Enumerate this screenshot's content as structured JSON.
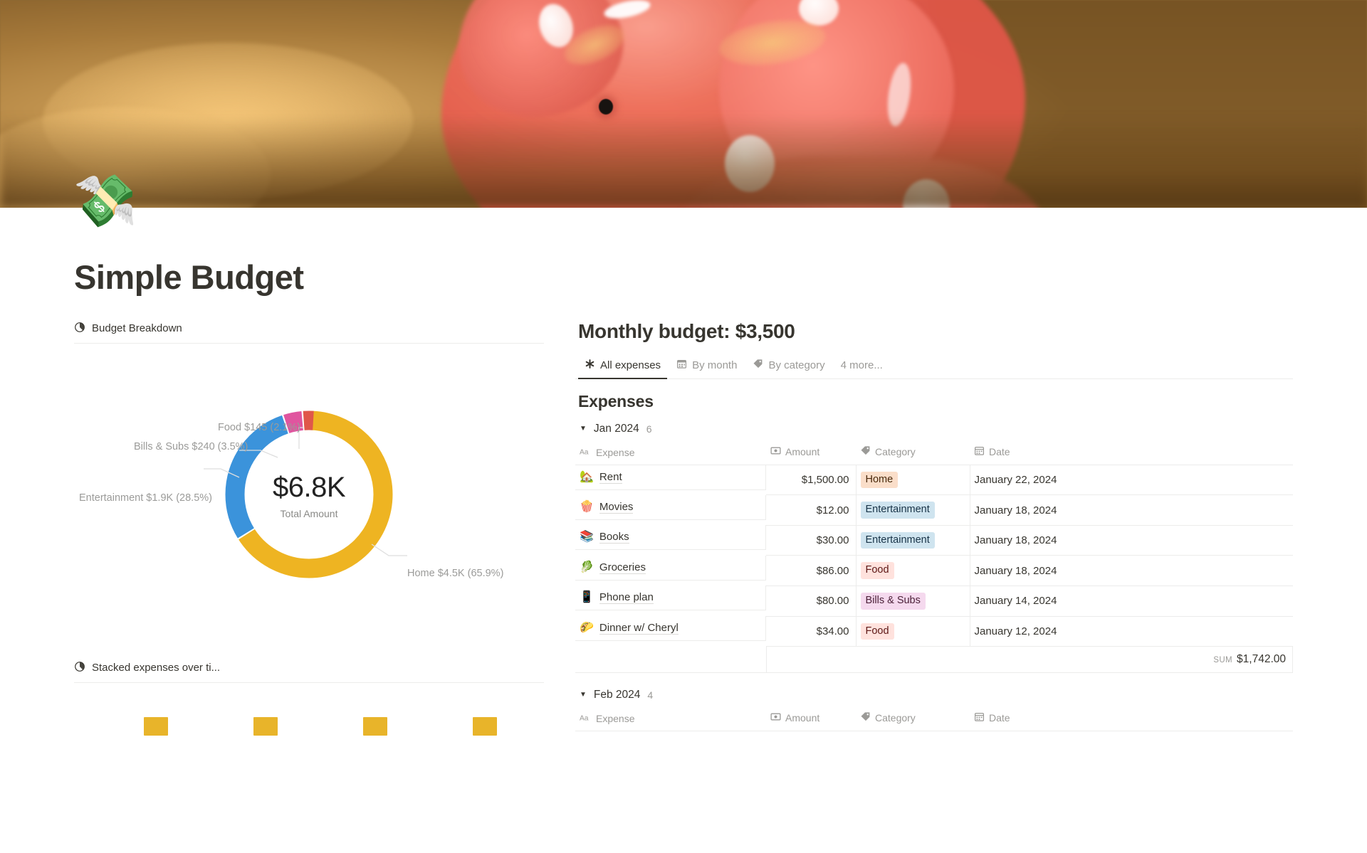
{
  "cover": {
    "alt": "piggy-bank-photo"
  },
  "page": {
    "emoji": "💸",
    "title": "Simple Budget"
  },
  "left": {
    "block1": {
      "icon": "pie-chart-icon",
      "title": "Budget Breakdown"
    },
    "block2": {
      "icon": "pie-chart-icon",
      "title": "Stacked expenses over ti..."
    }
  },
  "chart_data": {
    "type": "pie",
    "title": "Budget Breakdown",
    "center_value": "$6.8K",
    "center_label": "Total Amount",
    "total": 6800,
    "labels": [
      "Food $145 (2.1%)",
      "Bills & Subs $240 (3.5%)",
      "Entertainment $1.9K (28.5%)",
      "Home $4.5K (65.9%)"
    ],
    "slices": [
      {
        "name": "Home",
        "value": 4500,
        "display": "$4.5K",
        "percent": 65.9,
        "color": "#eeb422"
      },
      {
        "name": "Entertainment",
        "value": 1900,
        "display": "$1.9K",
        "percent": 28.5,
        "color": "#3b93db"
      },
      {
        "name": "Bills & Subs",
        "value": 240,
        "display": "$240",
        "percent": 3.5,
        "color": "#e0559f"
      },
      {
        "name": "Food",
        "value": 145,
        "display": "$145",
        "percent": 2.1,
        "color": "#e0574a"
      }
    ],
    "legend": "labeled-callouts",
    "grid": false
  },
  "database": {
    "title": "Monthly budget: $3,500",
    "tabs": [
      {
        "label": "All expenses",
        "icon": "asterisk-icon",
        "active": true
      },
      {
        "label": "By month",
        "icon": "calendar-icon",
        "active": false
      },
      {
        "label": "By category",
        "icon": "tag-icon",
        "active": false
      }
    ],
    "more_label": "4 more...",
    "name": "Expenses",
    "columns": [
      {
        "label": "Expense",
        "icon": "text-aa-icon"
      },
      {
        "label": "Amount",
        "icon": "currency-icon"
      },
      {
        "label": "Category",
        "icon": "tag-icon"
      },
      {
        "label": "Date",
        "icon": "calendar-icon"
      }
    ],
    "groups": [
      {
        "name": "Jan 2024",
        "count": "6",
        "rows": [
          {
            "emoji": "🏡",
            "expense": "Rent",
            "amount": "$1,500.00",
            "category": "Home",
            "category_class": "home",
            "date": "January 22, 2024"
          },
          {
            "emoji": "🍿",
            "expense": "Movies",
            "amount": "$12.00",
            "category": "Entertainment",
            "category_class": "enter",
            "date": "January 18, 2024"
          },
          {
            "emoji": "📚",
            "expense": "Books",
            "amount": "$30.00",
            "category": "Entertainment",
            "category_class": "enter",
            "date": "January 18, 2024"
          },
          {
            "emoji": "🥬",
            "expense": "Groceries",
            "amount": "$86.00",
            "category": "Food",
            "category_class": "food",
            "date": "January 18, 2024"
          },
          {
            "emoji": "📱",
            "expense": "Phone plan",
            "amount": "$80.00",
            "category": "Bills & Subs",
            "category_class": "bills",
            "date": "January 14, 2024"
          },
          {
            "emoji": "🌮",
            "expense": "Dinner w/ Cheryl",
            "amount": "$34.00",
            "category": "Food",
            "category_class": "food",
            "date": "January 12, 2024"
          }
        ],
        "sum_label": "SUM",
        "sum_value": "$1,742.00"
      },
      {
        "name": "Feb 2024",
        "count": "4",
        "rows": [],
        "sum_label": "",
        "sum_value": ""
      }
    ]
  }
}
